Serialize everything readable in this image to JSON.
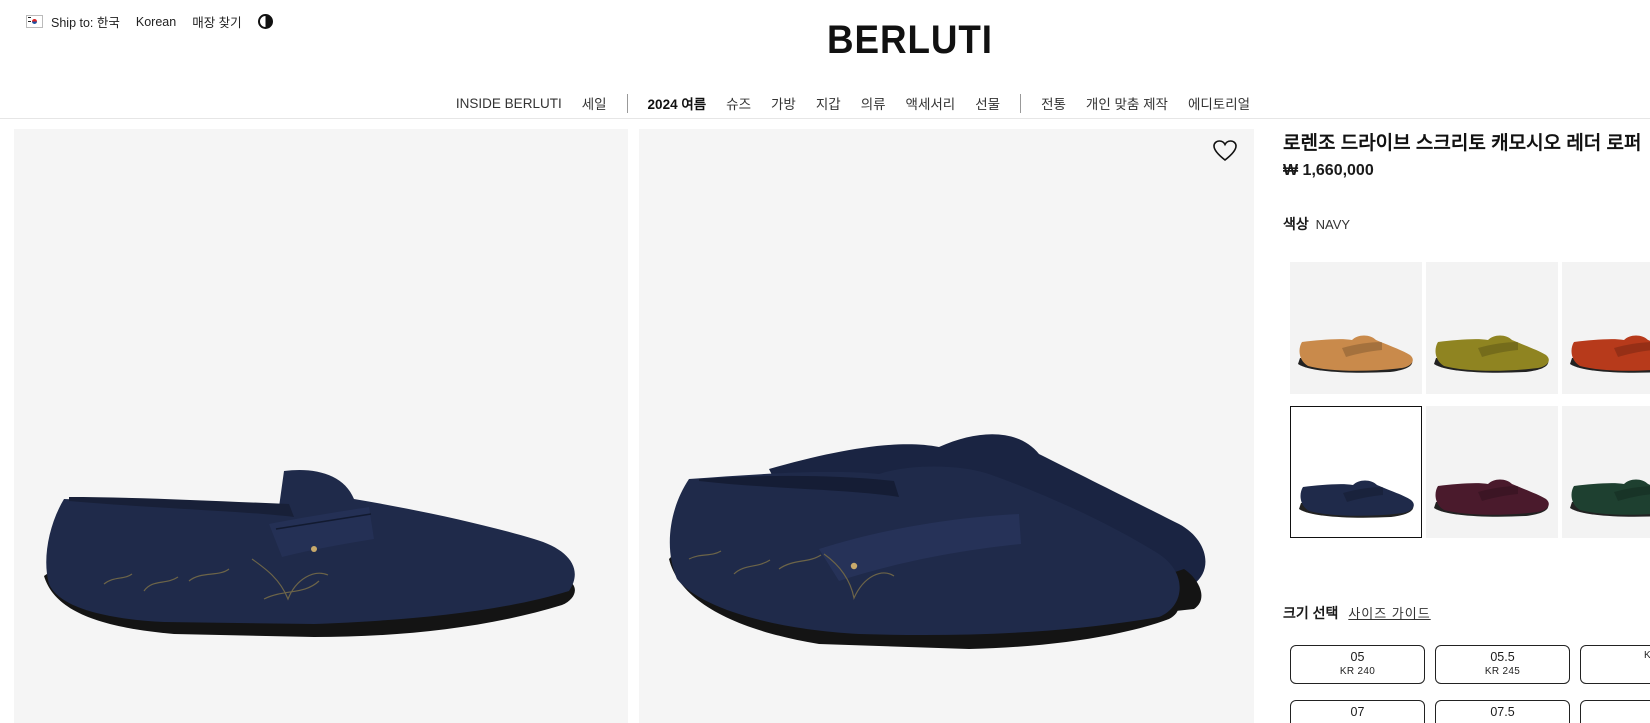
{
  "utility": {
    "ship_label": "Ship to: 한국",
    "language": "Korean",
    "store_finder": "매장 찾기"
  },
  "logo": "BERLUTI",
  "nav": {
    "groups": [
      [
        "INSIDE BERLUTI",
        "세일"
      ],
      [
        "2024 여름",
        "슈즈",
        "가방",
        "지갑",
        "의류",
        "액세서리",
        "선물"
      ],
      [
        "전통",
        "개인 맞춤 제작",
        "에디토리얼"
      ]
    ]
  },
  "product": {
    "title": "로렌조 드라이브 스크리토 캐모시오 레더 로퍼",
    "price": "₩ 1,660,000",
    "color_label": "색상",
    "color_value": "NAVY"
  },
  "swatches": [
    {
      "name": "tan",
      "color": "#c98a4b",
      "selected": false
    },
    {
      "name": "olive",
      "color": "#8f8421",
      "selected": false
    },
    {
      "name": "red",
      "color": "#b73a1b",
      "selected": false
    },
    {
      "name": "navy",
      "color": "#1f2a4a",
      "selected": true
    },
    {
      "name": "burgundy",
      "color": "#4a1a2c",
      "selected": false
    },
    {
      "name": "green",
      "color": "#1e4030",
      "selected": false
    }
  ],
  "size_section": {
    "label": "크기 선택",
    "guide_link": "사이즈 가이드"
  },
  "sizes": [
    {
      "size": "05",
      "kr": "KR 240"
    },
    {
      "size": "05.5",
      "kr": "KR 245"
    },
    {
      "size": "",
      "kr": "K"
    },
    {
      "size": "07",
      "kr": ""
    },
    {
      "size": "07.5",
      "kr": ""
    },
    {
      "size": "",
      "kr": ""
    }
  ],
  "colors": {
    "navy": "#1f2a4a",
    "panel_bg": "#f5f5f5",
    "text": "#1a1a1a"
  }
}
